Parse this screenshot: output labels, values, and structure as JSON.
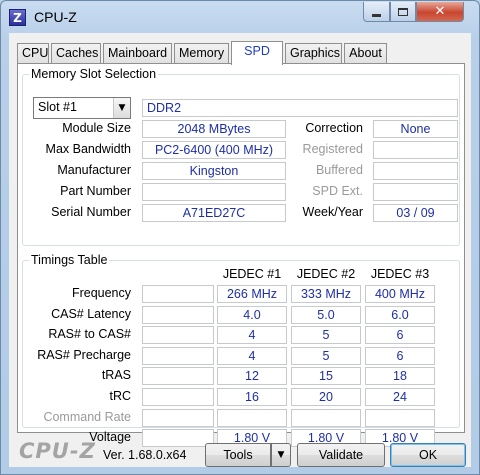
{
  "window": {
    "title": "CPU-Z",
    "icon_letter": "Z",
    "close_glyph": "✕"
  },
  "tabs": [
    "CPU",
    "Caches",
    "Mainboard",
    "Memory",
    "SPD",
    "Graphics",
    "About"
  ],
  "active_tab": "SPD",
  "memory_slot": {
    "group_title": "Memory Slot Selection",
    "slot_selected": "Slot #1",
    "type": "DDR2",
    "module_size_label": "Module Size",
    "module_size": "2048 MBytes",
    "max_bandwidth_label": "Max Bandwidth",
    "max_bandwidth": "PC2-6400 (400 MHz)",
    "manufacturer_label": "Manufacturer",
    "manufacturer": "Kingston",
    "part_number_label": "Part Number",
    "part_number": "",
    "serial_number_label": "Serial Number",
    "serial_number": "A71ED27C",
    "correction_label": "Correction",
    "correction": "None",
    "registered_label": "Registered",
    "registered": "",
    "buffered_label": "Buffered",
    "buffered": "",
    "spd_ext_label": "SPD Ext.",
    "spd_ext": "",
    "week_year_label": "Week/Year",
    "week_year": "03 / 09"
  },
  "timings": {
    "group_title": "Timings Table",
    "columns": [
      "JEDEC #1",
      "JEDEC #2",
      "JEDEC #3"
    ],
    "rows": [
      {
        "label": "Frequency",
        "disabled": false,
        "values": [
          "266 MHz",
          "333 MHz",
          "400 MHz"
        ]
      },
      {
        "label": "CAS# Latency",
        "disabled": false,
        "values": [
          "4.0",
          "5.0",
          "6.0"
        ]
      },
      {
        "label": "RAS# to CAS#",
        "disabled": false,
        "values": [
          "4",
          "5",
          "6"
        ]
      },
      {
        "label": "RAS# Precharge",
        "disabled": false,
        "values": [
          "4",
          "5",
          "6"
        ]
      },
      {
        "label": "tRAS",
        "disabled": false,
        "values": [
          "12",
          "15",
          "18"
        ]
      },
      {
        "label": "tRC",
        "disabled": false,
        "values": [
          "16",
          "20",
          "24"
        ]
      },
      {
        "label": "Command Rate",
        "disabled": true,
        "values": [
          "",
          "",
          ""
        ]
      },
      {
        "label": "Voltage",
        "disabled": false,
        "values": [
          "1.80 V",
          "1.80 V",
          "1.80 V"
        ]
      }
    ]
  },
  "footer": {
    "brand": "CPU-Z",
    "version": "Ver. 1.68.0.x64",
    "tools_label": "Tools",
    "validate_label": "Validate",
    "ok_label": "OK"
  }
}
